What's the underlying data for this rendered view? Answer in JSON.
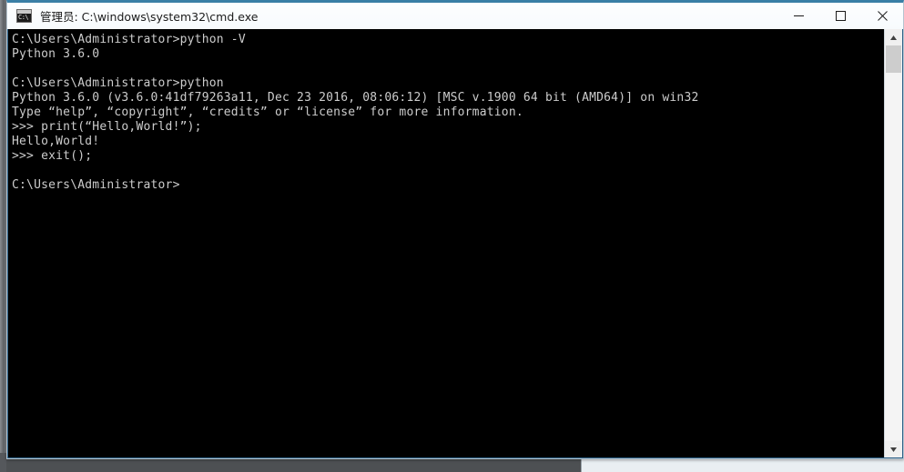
{
  "window": {
    "title": "管理员: C:\\windows\\system32\\cmd.exe",
    "icon_name": "cmd-console-icon",
    "icon_glyph": "C:\\",
    "accent_color": "#3a7fa6",
    "titlebar_bg": "#fbfdfe",
    "client_bg": "#000000",
    "text_color": "#cccccc"
  },
  "controls": {
    "minimize_label": "Minimize",
    "maximize_label": "Maximize",
    "close_label": "Close"
  },
  "scrollbar": {
    "up_arrow_label": "Scroll up",
    "down_arrow_label": "Scroll down",
    "thumb_label": "Vertical scroll thumb"
  },
  "terminal": {
    "lines": [
      "C:\\Users\\Administrator>python -V",
      "Python 3.6.0",
      "",
      "C:\\Users\\Administrator>python",
      "Python 3.6.0 (v3.6.0:41df79263a11, Dec 23 2016, 08:06:12) [MSC v.1900 64 bit (AMD64)] on win32",
      "Type “help”, “copyright”, “credits” or “license” for more information.",
      ">>> print(“Hello,World!”);",
      "Hello,World!",
      ">>> exit();",
      "",
      "C:\\Users\\Administrator>"
    ],
    "content": "C:\\Users\\Administrator>python -V\nPython 3.6.0\n\nC:\\Users\\Administrator>python\nPython 3.6.0 (v3.6.0:41df79263a11, Dec 23 2016, 08:06:12) [MSC v.1900 64 bit (AMD64)] on win32\nType “help”, “copyright”, “credits” or “license” for more information.\n>>> print(“Hello,World!”);\nHello,World!\n>>> exit();\n\nC:\\Users\\Administrator>"
  }
}
